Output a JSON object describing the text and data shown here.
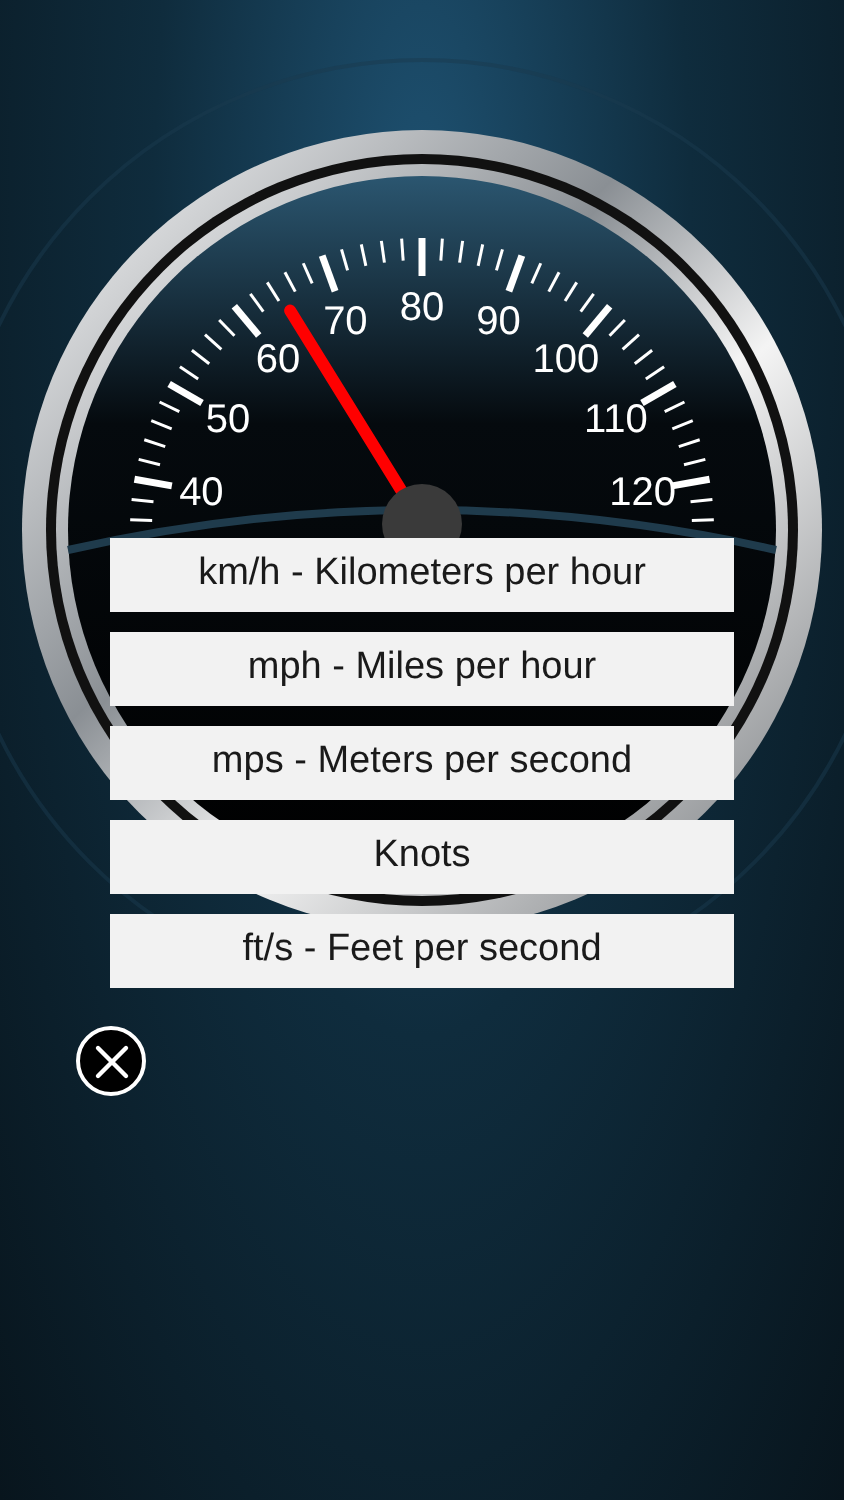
{
  "dial_numbers": [
    "40",
    "50",
    "60",
    "70",
    "80",
    "90",
    "100",
    "110",
    "120"
  ],
  "units": [
    {
      "label": "km/h - Kilometers per hour"
    },
    {
      "label": "mph - Miles per hour"
    },
    {
      "label": "mps - Meters per second"
    },
    {
      "label": "Knots"
    },
    {
      "label": "ft/s - Feet per second"
    }
  ]
}
